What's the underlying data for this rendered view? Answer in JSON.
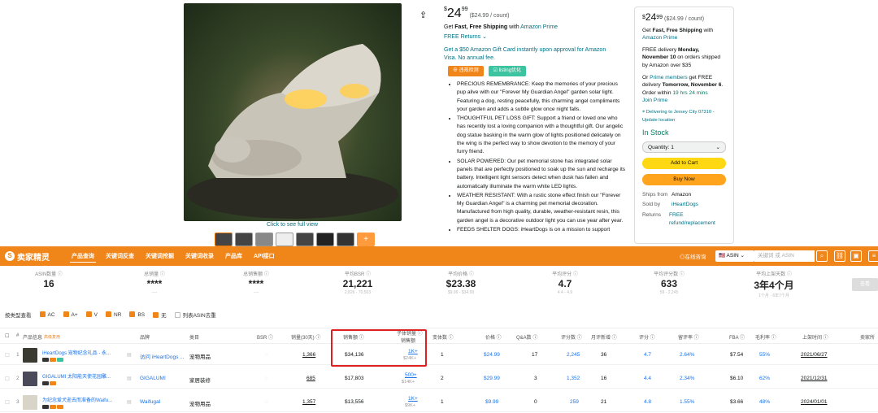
{
  "product": {
    "see_full": "Click to see full view",
    "share": "⇪",
    "thumbs_more": "+"
  },
  "center": {
    "price_whole": "24",
    "price_cents": "99",
    "price_note": "($24.99 / count)",
    "ship_pre": "Get ",
    "ship_bold": "Fast, Free Shipping",
    "ship_mid": " with ",
    "ship_link": "Amazon Prime",
    "returns": "FREE Returns ⌄",
    "gift": "Get a $50 Amazon Gift Card instantly upon approval for Amazon Visa. No annual fee.",
    "btn1": "⊕ 违规检测",
    "btn2": "☑ listing优化",
    "bullets": [
      "PRECIOUS REMEMBRANCE: Keep the memories of your precious pup alive with our \"Forever My Guardian Angel\" garden solar light. Featuring a dog, resting peacefully, this charming angel compliments your garden and adds a subtle glow once night falls.",
      "THOUGHTFUL PET LOSS GIFT: Support a friend or loved one who has recently lost a loving companion with a thoughtful gift. Our angelic dog statue basking in the warm glow of lights positioned delicately on the wing is the perfect way to show devotion to the memory of your furry friend.",
      "SOLAR POWERED: Our pet memorial stone has integrated solar panels that are perfectly positioned to soak up the sun and recharge its battery. Intelligent light sensors detect when dusk has fallen and automatically illuminate the warm white LED lights.",
      "WEATHER RESISTANT: With a rustic stone effect finish our \"Forever My Guardian Angel\" is a charming pet memorial decoration. Manufactured from high quality, durable, weather-resistant resin, this garden angel is a decorative outdoor light you can use year after year.",
      "FEEDS SHELTER DOGS: iHeartDogs is on a mission to support"
    ]
  },
  "buybox": {
    "price_whole": "24",
    "price_cents": "99",
    "price_note": "($24.99 / count)",
    "ship_pre": "Get ",
    "ship_bold": "Fast, Free Shipping",
    "ship_mid": " with ",
    "ship_link": "Amazon Prime",
    "free1": "FREE delivery ",
    "free1b": "Monday, November 10",
    "free1c": " on orders shipped by Amazon over $35",
    "or": "Or ",
    "prime_members": "Prime members",
    "or2": " get FREE delivery ",
    "tomorrow": "Tomorrow, November 6",
    "order_within": ". Order within ",
    "hrs": "19 hrs 24 mins",
    "join": "Join Prime",
    "deliver": "Delivering to Jersey City 07310 - Update location",
    "stock": "In Stock",
    "qty": "Quantity: 1",
    "cart": "Add to Cart",
    "buy": "Buy Now",
    "ships_k": "Ships from",
    "ships_v": "Amazon",
    "sold_k": "Sold by",
    "sold_v": "iHeartDogs",
    "ret_k": "Returns",
    "ret_v": "FREE refund/replacement"
  },
  "plugin": {
    "logo": "卖家精灵",
    "nav": [
      "产品查询",
      "关键词反查",
      "关键词挖掘",
      "关键词收录",
      "产品库",
      "API接口"
    ],
    "online": "◎在线咨询",
    "market": "🇺🇸 ASIN ⌄",
    "search_ph": "关键词 或 ASIN",
    "stats": [
      {
        "label": "ASIN数量 ⓘ",
        "value": "16",
        "range": ""
      },
      {
        "label": "总销量 ⓘ",
        "value": "****",
        "range": "----"
      },
      {
        "label": "总销售额 ⓘ",
        "value": "****",
        "range": "----"
      },
      {
        "label": "平均BSR ⓘ",
        "value": "21,221",
        "range": "2,826 - 70,503"
      },
      {
        "label": "平均价格 ⓘ",
        "value": "$23.38",
        "range": "$9.99 - $34.99"
      },
      {
        "label": "平均评分 ⓘ",
        "value": "4.7",
        "range": "4.4 - 4.9"
      },
      {
        "label": "平均评分数 ⓘ",
        "value": "633",
        "range": "59 - 2,245"
      },
      {
        "label": "平均上架天数 ⓘ",
        "value": "3年4个月",
        "range": "1个月 - 6年7个月"
      }
    ],
    "stat_btn": "查看",
    "filter_label": "按类型查看",
    "filters": [
      "AC",
      "A+",
      "V",
      "NR",
      "BS",
      "无"
    ],
    "filter_last": "列表ASIN去重",
    "headers": [
      "#",
      "产品信息",
      "品牌",
      "类目",
      "BSR ⓘ",
      "销量(30天) ⓘ",
      "销售额 ⓘ",
      "子体销量 ⓘ",
      "变体数 ⓘ",
      "价格 ⓘ",
      "Q&A数 ⓘ",
      "评分数 ⓘ",
      "月评新增 ⓘ",
      "评分 ⓘ",
      "留评率 ⓘ",
      "FBA ⓘ",
      "毛利率 ⓘ",
      "上架时间 ⓘ",
      "卖家所"
    ],
    "child_sales_sub": "子体销量 ⓘ",
    "child_rev_sub": "销售额",
    "new_tag": "高级复用",
    "rows": [
      {
        "idx": "1",
        "name": "iHeartDogs 宠物纪念礼品 - 永...",
        "brand": "访问 iHeartDogs ...",
        "cat": "宠物用品",
        "sales": "1,366",
        "rev": "$34,136",
        "child": "1K+",
        "child2": "$24K+",
        "var": "1",
        "price": "$24.99",
        "qa": "17",
        "reviews": "2,245",
        "monthly": "36",
        "rating": "4.7",
        "rate": "2.64%",
        "fba": "$7.54",
        "margin": "55%",
        "date": "2021/06/27"
      },
      {
        "idx": "2",
        "name": "GIGALUMI 太阳能天使花园雕...",
        "brand": "GIGALUMI",
        "cat": "家居装修",
        "sales": "685",
        "rev": "$17,803",
        "child": "500+",
        "child2": "$14K+",
        "var": "2",
        "price": "$29.99",
        "qa": "3",
        "reviews": "1,352",
        "monthly": "16",
        "rating": "4.4",
        "rate": "2.34%",
        "fba": "$6.10",
        "margin": "62%",
        "date": "2021/12/31"
      },
      {
        "idx": "3",
        "name": "为纪念爱犬逝去而准备的Waifu...",
        "brand": "Waifugal",
        "cat": "宠物用品",
        "sales": "1,357",
        "rev": "$13,556",
        "child": "1K+",
        "child2": "$9K+",
        "var": "1",
        "price": "$9.99",
        "qa": "0",
        "reviews": "259",
        "monthly": "21",
        "rating": "4.8",
        "rate": "1.55%",
        "fba": "$3.66",
        "margin": "48%",
        "date": "2024/01/01"
      }
    ]
  },
  "colors": {
    "accent": "#f08519",
    "highlight": "#e02020",
    "link": "#007185"
  }
}
